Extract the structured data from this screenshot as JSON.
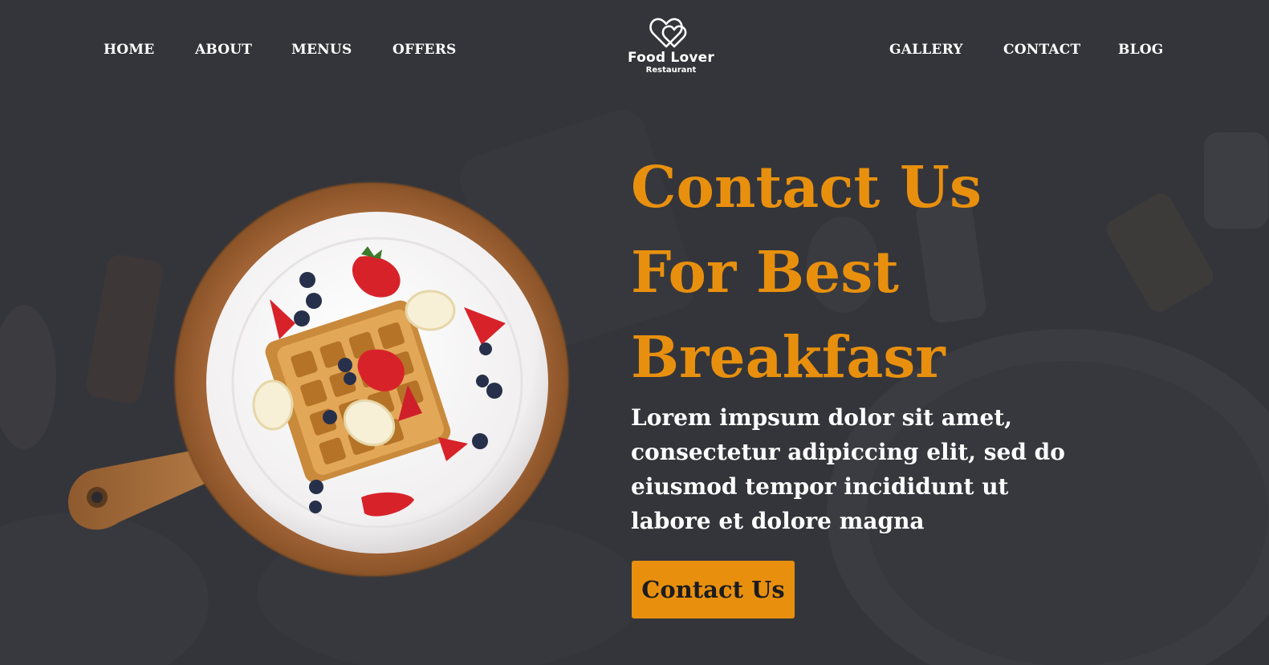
{
  "nav": {
    "left_items": [
      {
        "label": "HOME"
      },
      {
        "label": "ABOUT"
      },
      {
        "label": "MENUS"
      },
      {
        "label": "OFFERS"
      }
    ],
    "right_items": [
      {
        "label": "GALLERY"
      },
      {
        "label": "CONTACT"
      },
      {
        "label": "BLOG"
      }
    ]
  },
  "logo": {
    "name": "Food Lover",
    "subtitle": "Restaurant",
    "icon": "double-heart-icon"
  },
  "hero": {
    "title_lines": [
      "Contact Us",
      "For Best",
      "Breakfasr"
    ],
    "description": "Lorem impsum dolor sit amet, consectetur adipiccing elit, sed do eiusmod tempor incididunt ut labore et dolore magna",
    "cta_label": "Contact Us",
    "image": "waffle-plate-on-wooden-board"
  },
  "colors": {
    "background": "#34353a",
    "accent": "#e8900e",
    "text": "#ffffff"
  }
}
